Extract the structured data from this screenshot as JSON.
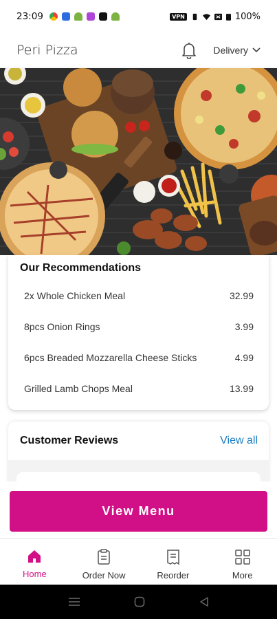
{
  "status_bar": {
    "time": "23:09",
    "vpn": "VPN",
    "battery": "100%"
  },
  "header": {
    "title": "Peri Pizza",
    "delivery_label": "Delivery"
  },
  "recommendations": {
    "title": "Our Recommendations",
    "items": [
      {
        "name": "2x Whole Chicken Meal",
        "price": "32.99"
      },
      {
        "name": "8pcs Onion Rings",
        "price": "3.99"
      },
      {
        "name": "6pcs Breaded Mozzarella Cheese Sticks",
        "price": "4.99"
      },
      {
        "name": "Grilled Lamb Chops Meal",
        "price": "13.99"
      }
    ]
  },
  "reviews": {
    "title": "Customer Reviews",
    "view_all": "View all"
  },
  "cta": {
    "label": "View Menu"
  },
  "bottom_nav": {
    "items": [
      {
        "label": "Home",
        "icon": "home-icon"
      },
      {
        "label": "Order Now",
        "icon": "order-icon"
      },
      {
        "label": "Reorder",
        "icon": "receipt-icon"
      },
      {
        "label": "More",
        "icon": "grid-icon"
      }
    ]
  },
  "colors": {
    "accent": "#d10f86",
    "link": "#1b7fc4"
  }
}
